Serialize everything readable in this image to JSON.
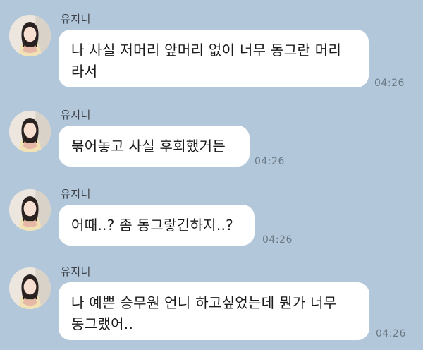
{
  "messages": [
    {
      "sender": "유지니",
      "text": "나 사실 저머리 앞머리 없이 너무 동그란 머리\n라서",
      "time": "04:26"
    },
    {
      "sender": "유지니",
      "text": "묶어놓고 사실 후회했거든",
      "time": "04:26"
    },
    {
      "sender": "유지니",
      "text": "어때..? 좀 동그랗긴하지..?",
      "time": "04:26"
    },
    {
      "sender": "유지니",
      "text": "나 예쁜 승무원 언니 하고싶었는데 뭔가 너무\n동그랬어..",
      "time": "04:26"
    }
  ]
}
